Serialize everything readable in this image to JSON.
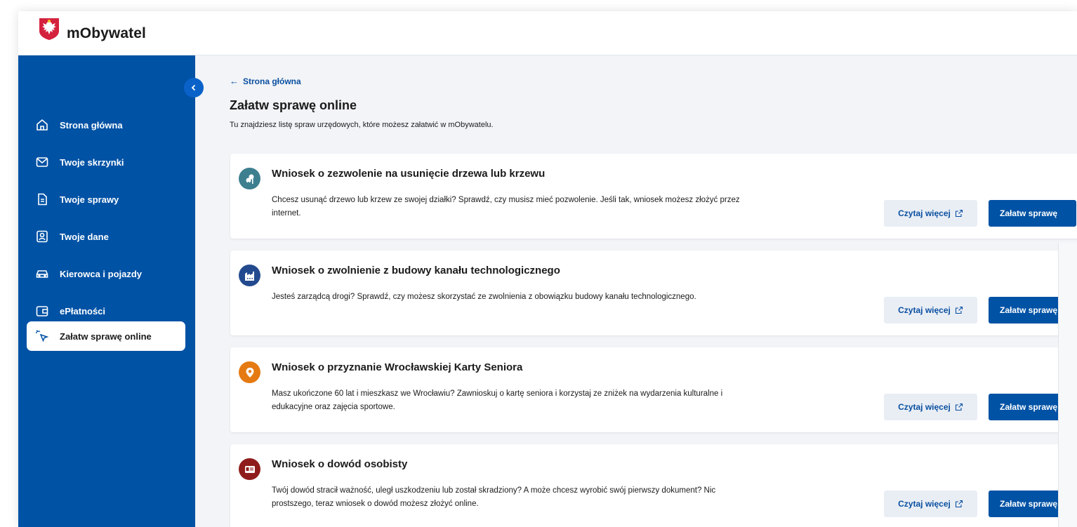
{
  "header": {
    "app_title": "mObywatel",
    "logo_icon": "polish-eagle-emblem"
  },
  "sidebar": {
    "collapse_icon": "chevron-left-icon",
    "items": [
      {
        "label": "Strona główna",
        "icon": "home-icon"
      },
      {
        "label": "Twoje skrzynki",
        "icon": "mail-icon"
      },
      {
        "label": "Twoje sprawy",
        "icon": "document-icon"
      },
      {
        "label": "Twoje dane",
        "icon": "id-badge-icon"
      },
      {
        "label": "Kierowca i pojazdy",
        "icon": "car-icon"
      },
      {
        "label": "ePłatności",
        "icon": "wallet-icon"
      },
      {
        "label": "Załatw sprawę online",
        "icon": "cursor-click-icon",
        "active": true
      }
    ]
  },
  "main": {
    "back_link": "Strona główna",
    "title": "Załatw sprawę online",
    "subtitle": "Tu znajdziesz listę spraw urzędowych, które możesz załatwić w mObywatelu.",
    "more_label": "Czytaj więcej",
    "go_label": "Załatw sprawę",
    "cards": [
      {
        "title": "Wniosek o zezwolenie na usunięcie drzewa lub krzewu",
        "description": "Chcesz usunąć drzewo lub krzew ze swojej działki? Sprawdź, czy musisz mieć pozwolenie. Jeśli tak, wniosek możesz złożyć przez internet.",
        "icon": "tree-icon",
        "color": "#3d7f8f"
      },
      {
        "title": "Wniosek o zwolnienie z budowy kanału technologicznego",
        "description": "Jesteś zarządcą drogi? Sprawdź, czy możesz skorzystać ze zwolnienia z obowiązku budowy kanału technologicznego.",
        "icon": "factory-icon",
        "color": "#234a8f"
      },
      {
        "title": "Wniosek o przyznanie Wrocławskiej Karty Seniora",
        "description": "Masz ukończone 60 lat i mieszkasz we Wrocławiu? Zawnioskuj o kartę seniora i korzystaj ze zniżek na wydarzenia kulturalne i edukacyjne oraz zajęcia sportowe.",
        "icon": "location-pin-icon",
        "color": "#e57a12"
      },
      {
        "title": "Wniosek o dowód osobisty",
        "description": "Twój dowód stracił ważność, uległ uszkodzeniu lub został skradziony? A może chcesz wyrobić swój pierwszy dokument? Nic prostszego, teraz wniosek o dowód możesz złożyć online.",
        "icon": "id-card-icon",
        "color": "#8f1c1c"
      }
    ]
  }
}
